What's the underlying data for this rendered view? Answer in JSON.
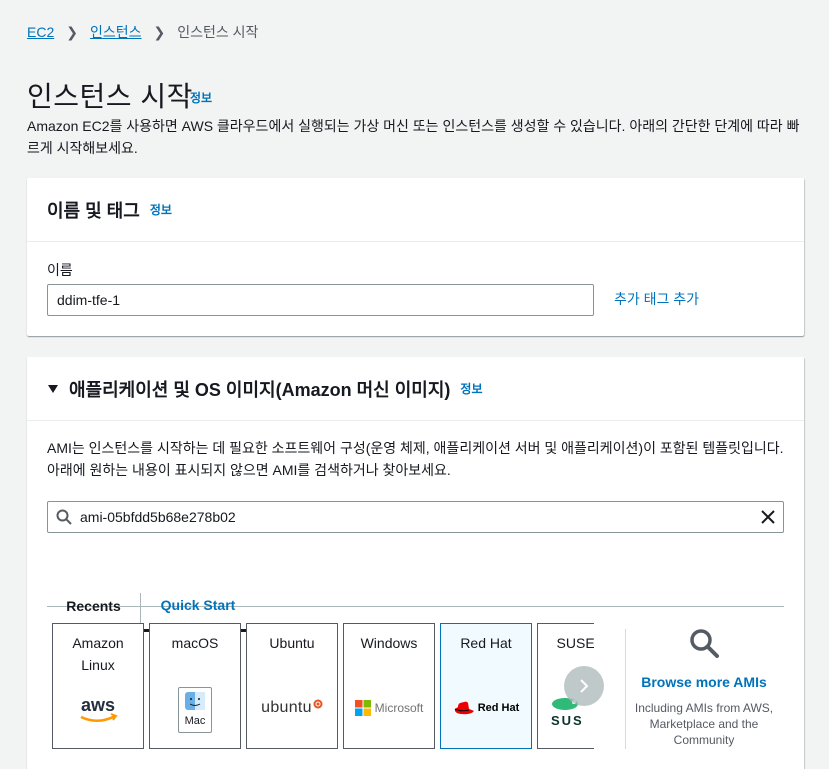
{
  "breadcrumb": {
    "root": "EC2",
    "parent": "인스턴스",
    "current": "인스턴스 시작"
  },
  "page": {
    "title": "인스턴스 시작",
    "info": "정보",
    "description": "Amazon EC2를 사용하면 AWS 클라우드에서 실행되는 가상 머신 또는 인스턴스를 생성할 수 있습니다. 아래의 간단한 단계에 따라 빠르게 시작해보세요."
  },
  "name_tags": {
    "title": "이름 및 태그",
    "info": "정보",
    "name_label": "이름",
    "name_value": "ddim-tfe-1",
    "add_tags": "추가 태그 추가"
  },
  "ami": {
    "title": "애플리케이션 및 OS 이미지(Amazon 머신 이미지)",
    "info": "정보",
    "description": "AMI는 인스턴스를 시작하는 데 필요한 소프트웨어 구성(운영 체제, 애플리케이션 서버 및 애플리케이션)이 포함된 템플릿입니다. 아래에 원하는 내용이 표시되지 않으면 AMI를 검색하거나 찾아보세요.",
    "search_value": "ami-05bfdd5b68e278b02",
    "tabs": [
      {
        "label": "Recents",
        "active": false
      },
      {
        "label": "Quick Start",
        "active": true
      }
    ],
    "cards": [
      {
        "title": "Amazon\nLinux",
        "logo": "aws",
        "selected": false
      },
      {
        "title": "macOS",
        "logo": "Mac",
        "selected": false
      },
      {
        "title": "Ubuntu",
        "logo": "ubuntu",
        "selected": false
      },
      {
        "title": "Windows",
        "logo": "Microsoft",
        "selected": false
      },
      {
        "title": "Red Hat",
        "logo": "Red Hat",
        "selected": true
      },
      {
        "title": "SUSE Li",
        "logo": "SUS",
        "selected": false
      }
    ],
    "browse": {
      "title": "Browse more AMIs",
      "description": "Including AMIs from AWS, Marketplace and the Community"
    }
  },
  "colors": {
    "link": "#0073bb",
    "background": "#f2f3f3",
    "text": "#16191f",
    "selected_card_bg": "#f1faff"
  }
}
